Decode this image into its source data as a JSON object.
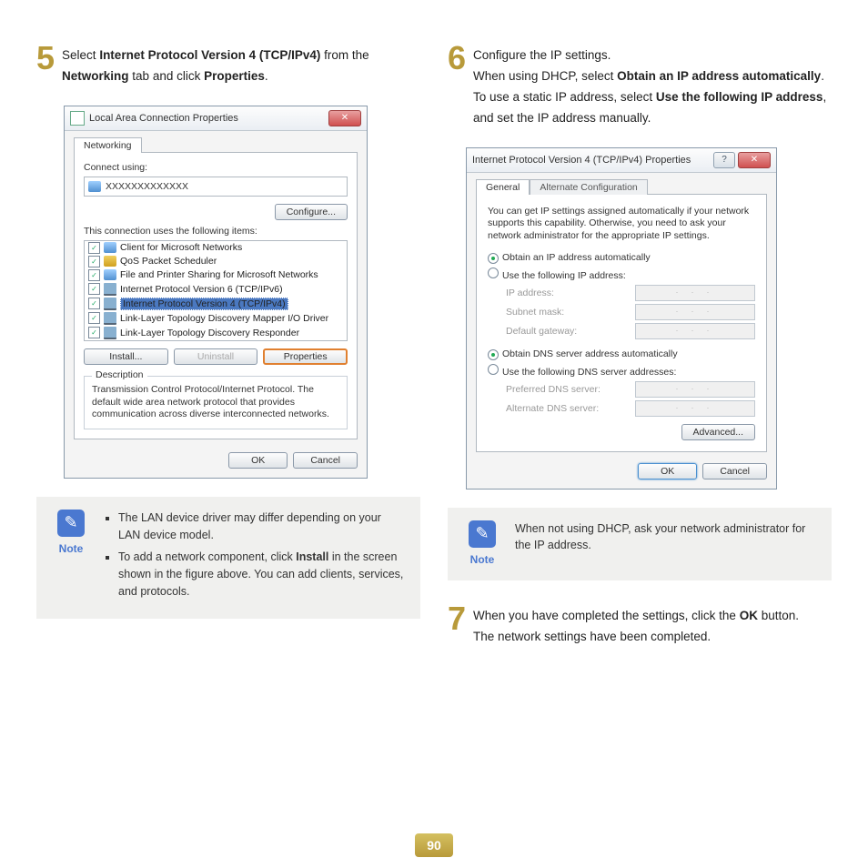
{
  "page_number": "90",
  "steps": {
    "s5_num": "5",
    "s5_a": "Select ",
    "s5_b": "Internet Protocol Version 4 (TCP/IPv4)",
    "s5_c": " from the ",
    "s5_d": "Networking",
    "s5_e": " tab and click ",
    "s5_f": "Properties",
    "s5_g": ".",
    "s6_num": "6",
    "s6_a": "Configure the IP settings.",
    "s6_b": "When using DHCP, select ",
    "s6_c": "Obtain an IP address automatically",
    "s6_d": ". To use a static IP address, select ",
    "s6_e": "Use the following IP address",
    "s6_f": ", and set the IP address manually.",
    "s7_num": "7",
    "s7_a": "When you have completed the settings, click the ",
    "s7_b": "OK",
    "s7_c": " button.",
    "s7_d": "The network settings have been completed."
  },
  "dlg1": {
    "title": "Local Area Connection Properties",
    "tab": "Networking",
    "connect_lbl": "Connect using:",
    "adapter": "XXXXXXXXXXXXX",
    "configure_btn": "Configure...",
    "items_lbl": "This connection uses the following items:",
    "items": [
      "Client for Microsoft Networks",
      "QoS Packet Scheduler",
      "File and Printer Sharing for Microsoft Networks",
      "Internet Protocol Version 6 (TCP/IPv6)",
      "Internet Protocol Version 4 (TCP/IPv4)",
      "Link-Layer Topology Discovery Mapper I/O Driver",
      "Link-Layer Topology Discovery Responder"
    ],
    "install_btn": "Install...",
    "uninstall_btn": "Uninstall",
    "properties_btn": "Properties",
    "desc_lbl": "Description",
    "desc_text": "Transmission Control Protocol/Internet Protocol. The default wide area network protocol that provides communication across diverse interconnected networks.",
    "ok_btn": "OK",
    "cancel_btn": "Cancel"
  },
  "dlg2": {
    "title": "Internet Protocol Version 4 (TCP/IPv4) Properties",
    "tab1": "General",
    "tab2": "Alternate Configuration",
    "intro": "You can get IP settings assigned automatically if your network supports this capability. Otherwise, you need to ask your network administrator for the appropriate IP settings.",
    "r1": "Obtain an IP address automatically",
    "r2": "Use the following IP address:",
    "ip_lbl": "IP address:",
    "mask_lbl": "Subnet mask:",
    "gw_lbl": "Default gateway:",
    "r3": "Obtain DNS server address automatically",
    "r4": "Use the following DNS server addresses:",
    "dns1_lbl": "Preferred DNS server:",
    "dns2_lbl": "Alternate DNS server:",
    "dots": ".       .       .",
    "adv_btn": "Advanced...",
    "ok_btn": "OK",
    "cancel_btn": "Cancel"
  },
  "note1": {
    "label": "Note",
    "b1": "The LAN device driver may differ depending on your LAN device model.",
    "b2a": "To add a network component, click ",
    "b2b": "Install",
    "b2c": " in the screen shown in the figure above. You can add clients, services, and protocols."
  },
  "note2": {
    "label": "Note",
    "text": "When not using DHCP, ask your network administrator for the IP address."
  }
}
